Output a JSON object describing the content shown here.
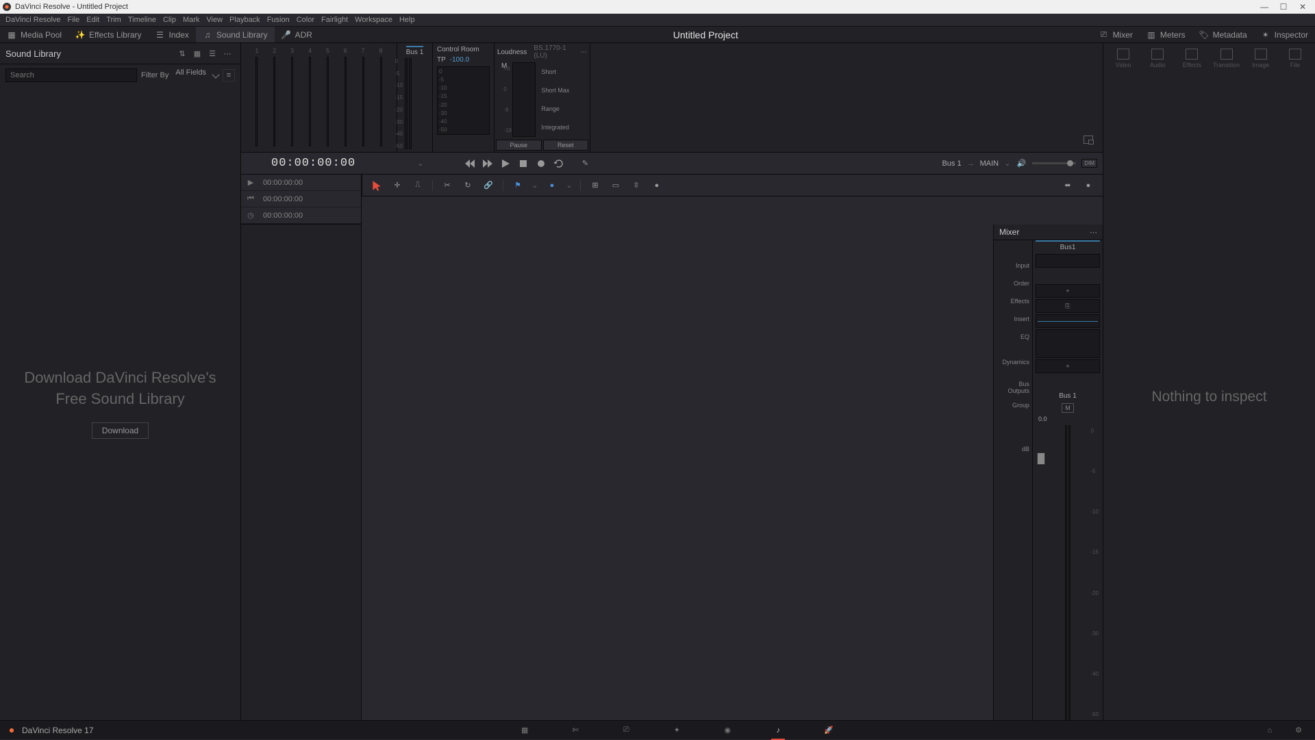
{
  "titlebar": {
    "app": "DaVinci Resolve",
    "doc": "Untitled Project"
  },
  "menu": [
    "DaVinci Resolve",
    "File",
    "Edit",
    "Trim",
    "Timeline",
    "Clip",
    "Mark",
    "View",
    "Playback",
    "Fusion",
    "Color",
    "Fairlight",
    "Workspace",
    "Help"
  ],
  "toolbar": {
    "media_pool": "Media Pool",
    "effects_library": "Effects Library",
    "index": "Index",
    "sound_library": "Sound Library",
    "adr": "ADR",
    "project_title": "Untitled Project",
    "mixer": "Mixer",
    "meters": "Meters",
    "metadata": "Metadata",
    "inspector": "Inspector"
  },
  "sound_library": {
    "title": "Sound Library",
    "search_placeholder": "Search",
    "filter_by": "Filter By",
    "all_fields": "All Fields",
    "prompt_line1": "Download DaVinci Resolve's",
    "prompt_line2": "Free Sound Library",
    "download": "Download"
  },
  "meters": {
    "bank_nums": [
      "1",
      "2",
      "3",
      "4",
      "5",
      "6",
      "7",
      "8"
    ],
    "bus1": "Bus 1",
    "bus1_scale": [
      "0",
      "-5",
      "-10",
      "-15",
      "-20",
      "-30",
      "-40",
      "-50"
    ],
    "control_room": "Control Room",
    "tp": "TP",
    "tp_val": "-100.0",
    "cr_scale": [
      "0",
      "-5",
      "-10",
      "-15",
      "-20",
      "-30",
      "-40",
      "-50"
    ],
    "loudness": "Loudness",
    "loud_std": "BS.1770-1 (LU)",
    "m": "M",
    "loud_scale": [
      "+9",
      "",
      "0",
      "",
      "-9",
      "",
      "-18"
    ],
    "short": "Short",
    "short_max": "Short Max",
    "range": "Range",
    "integrated": "Integrated",
    "pause": "Pause",
    "reset": "Reset"
  },
  "transport": {
    "tc_main": "00:00:00:00",
    "tc1": "00:00:00:00",
    "tc2": "00:00:00:00",
    "tc3": "00:00:00:00",
    "bus": "Bus 1",
    "main": "MAIN",
    "dim": "DIM"
  },
  "mixer": {
    "title": "Mixer",
    "bus1": "Bus1",
    "labels": {
      "input": "Input",
      "order": "Order",
      "effects": "Effects",
      "insert": "Insert",
      "eq": "EQ",
      "dynamics": "Dynamics",
      "bus_outputs": "Bus Outputs",
      "group": "Group",
      "db": "dB"
    },
    "bus_name": "Bus 1",
    "m": "M",
    "db_val": "0.0",
    "fader_scale": [
      "0",
      "-5",
      "-10",
      "-15",
      "-20",
      "-30",
      "-40",
      "-50"
    ]
  },
  "inspector": {
    "tabs": [
      "Video",
      "Audio",
      "Effects",
      "Transition",
      "Image",
      "File"
    ],
    "msg": "Nothing to inspect"
  },
  "bottom": {
    "label": "DaVinci Resolve 17"
  }
}
